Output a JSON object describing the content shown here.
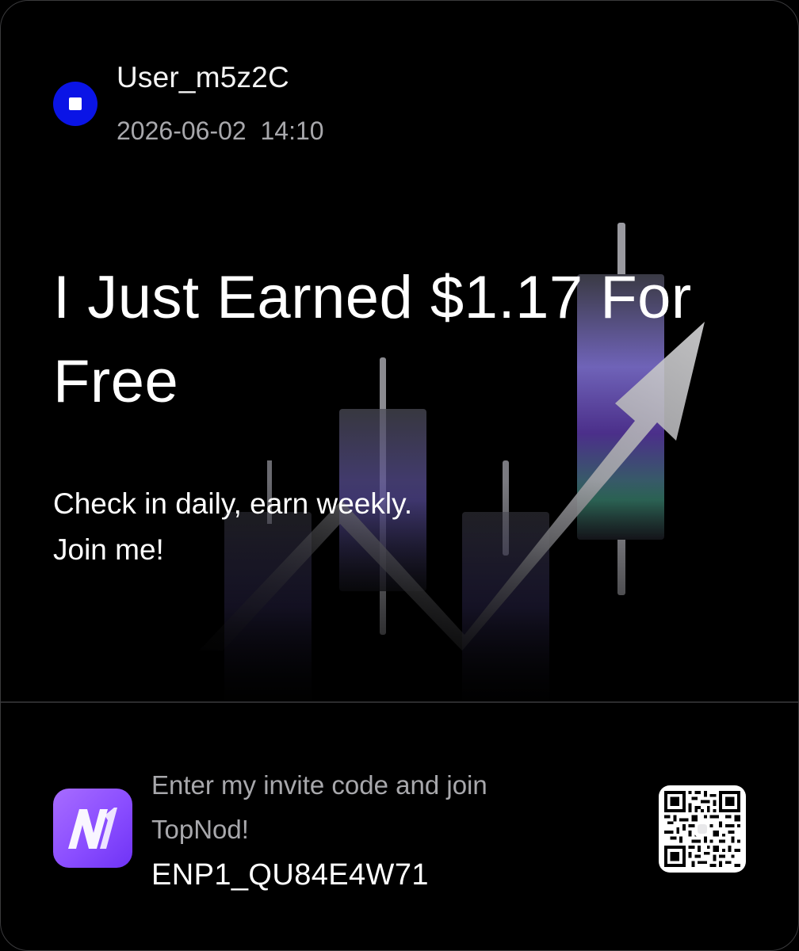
{
  "user": {
    "name": "User_m5z2C",
    "timestamp": "2026-06-02  14:10",
    "avatar_color": "#0a14e6"
  },
  "hero": {
    "headline": "I Just Earned $1.17 For Free",
    "tagline_line1": "Check in daily, earn weekly.",
    "tagline_line2": "Join me!",
    "illustration": "candlestick-chart-with-up-arrow"
  },
  "invite": {
    "text": "Enter my invite code and join TopNod!",
    "code": "ENP1_QU84E4W71",
    "app_icon": "topnod-logo-icon",
    "qr": "qr-code-icon"
  },
  "colors": {
    "background": "#000000",
    "accent_purple": "#8a4dff",
    "muted_text": "#a8a8ac"
  }
}
